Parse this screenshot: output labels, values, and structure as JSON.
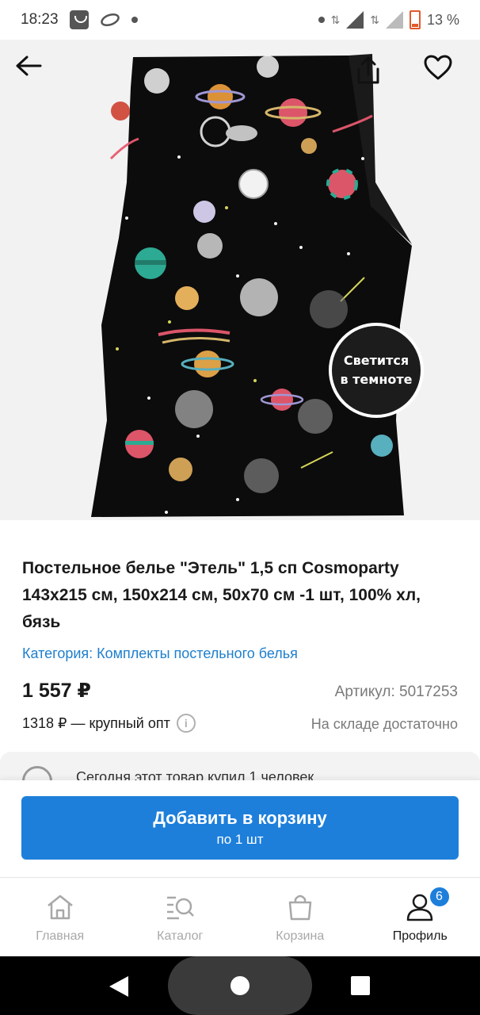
{
  "status_bar": {
    "time": "18:23",
    "battery_percent": "13 %"
  },
  "product": {
    "image_badge_line1": "Светится",
    "image_badge_line2": "в темноте",
    "title": "Постельное белье \"Этель\" 1,5 сп Cosmoparty 143х215 см, 150х214 см, 50х70 см -1 шт, 100% хл, бязь",
    "category": "Категория: Комплекты постельного белья",
    "price": "1 557 ₽",
    "sku": "Артикул: 5017253",
    "wholesale": "1318 ₽ — крупный опт",
    "stock": "На складе достаточно",
    "purchase_info": "Сегодня этот товар купил 1 человек"
  },
  "cart_button": {
    "label": "Добавить в корзину",
    "sublabel": "по 1 шт"
  },
  "bottom_nav": {
    "items": [
      {
        "label": "Главная",
        "icon": "home-icon"
      },
      {
        "label": "Каталог",
        "icon": "catalog-search-icon"
      },
      {
        "label": "Корзина",
        "icon": "bag-icon"
      },
      {
        "label": "Профиль",
        "icon": "profile-icon",
        "badge": "6",
        "active": true
      }
    ]
  },
  "colors": {
    "accent": "#1e7fdb",
    "link": "#1e7fce"
  }
}
